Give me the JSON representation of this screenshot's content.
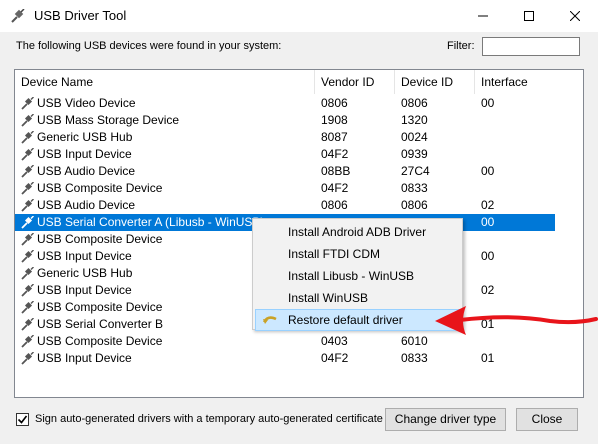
{
  "window": {
    "title": "USB Driver Tool"
  },
  "top": {
    "found_text": "The following USB devices were found in your system:",
    "filter_label": "Filter:",
    "filter_value": ""
  },
  "columns": [
    "Device Name",
    "Vendor ID",
    "Device ID",
    "Interface"
  ],
  "rows": [
    {
      "name": "USB Video Device",
      "vendor": "0806",
      "device": "0806",
      "interface": "00"
    },
    {
      "name": "USB Mass Storage Device",
      "vendor": "1908",
      "device": "1320",
      "interface": ""
    },
    {
      "name": "Generic USB Hub",
      "vendor": "8087",
      "device": "0024",
      "interface": ""
    },
    {
      "name": "USB Input Device",
      "vendor": "04F2",
      "device": "0939",
      "interface": ""
    },
    {
      "name": "USB Audio Device",
      "vendor": "08BB",
      "device": "27C4",
      "interface": "00"
    },
    {
      "name": "USB Composite Device",
      "vendor": "04F2",
      "device": "0833",
      "interface": ""
    },
    {
      "name": "USB Audio Device",
      "vendor": "0806",
      "device": "0806",
      "interface": "02"
    },
    {
      "name": "USB Serial Converter A (Libusb - WinUSB)",
      "vendor": "",
      "device": "",
      "interface": "00",
      "selected": true
    },
    {
      "name": "USB Composite Device",
      "vendor": "",
      "device": "",
      "interface": ""
    },
    {
      "name": "USB Input Device",
      "vendor": "",
      "device": "",
      "interface": "00"
    },
    {
      "name": "Generic USB Hub",
      "vendor": "",
      "device": "",
      "interface": ""
    },
    {
      "name": "USB Input Device",
      "vendor": "",
      "device": "",
      "interface": "02"
    },
    {
      "name": "USB Composite Device",
      "vendor": "",
      "device": "",
      "interface": ""
    },
    {
      "name": "USB Serial Converter B",
      "vendor": "",
      "device": "",
      "interface": "01"
    },
    {
      "name": "USB Composite Device",
      "vendor": "0403",
      "device": "6010",
      "interface": ""
    },
    {
      "name": "USB Input Device",
      "vendor": "04F2",
      "device": "0833",
      "interface": "01"
    }
  ],
  "context_menu": {
    "items": [
      "Install Android ADB Driver",
      "Install FTDI CDM",
      "Install Libusb - WinUSB",
      "Install WinUSB",
      "Restore default driver"
    ],
    "highlighted_index": 4,
    "highlighted_icon": "restore-arrow-icon"
  },
  "annotation": {
    "icon": "red-arrow-icon",
    "color": "#e8141a"
  },
  "bottom": {
    "checkbox_label": "Sign auto-generated drivers with a temporary auto-generated certificate",
    "checkbox_checked": true,
    "change_button": "Change driver type",
    "close_button": "Close"
  },
  "colors": {
    "selection": "#0078d7",
    "menu_highlight": "#cce8ff"
  }
}
